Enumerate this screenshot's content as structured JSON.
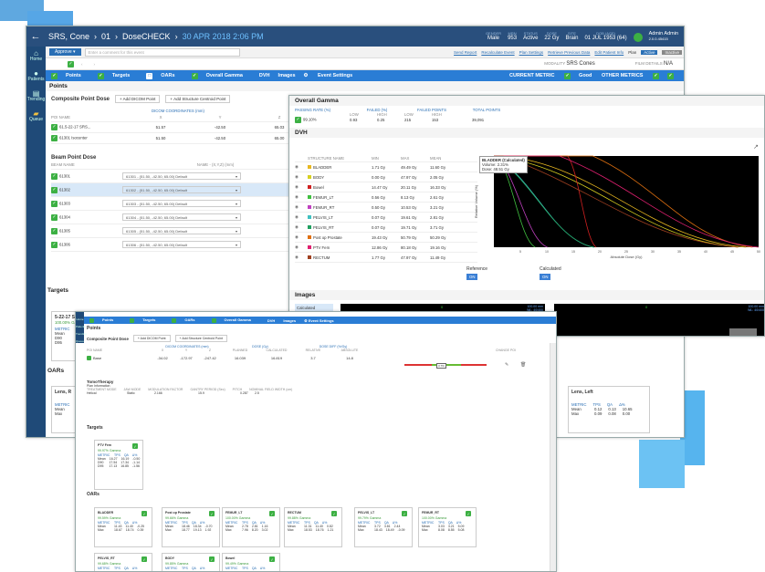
{
  "app": {
    "back_icon": "arrow-left-icon",
    "crumb1": "SRS, Cone",
    "crumb2": "01",
    "crumb3": "DoseCHECK",
    "date": "30 APR 2018 2:06 PM",
    "gender_label": "GENDER",
    "gender": "Male",
    "mrn_label": "MRN",
    "mrn": "953",
    "status_label": "STATUS",
    "status": "Active",
    "dose_label": "DOSE",
    "dose": "22 Gy",
    "site_label": "SITE",
    "site": "Brain",
    "dob_label": "DOB (AGE)",
    "dob": "01 JUL 1953 (64)",
    "user": "Admin Admin",
    "version": "2.0.0.45415"
  },
  "sidebar": {
    "home": "Home",
    "patients": "Patients",
    "trending": "Trending",
    "queue": "Queue"
  },
  "toolbar": {
    "approve": "Approve",
    "comment_placeholder": "Enter a comment for this event",
    "links": [
      "Send Report",
      "Recalculate Event",
      "Plan Settings",
      "Retrieve Previous Data",
      "Edit Patient Info"
    ],
    "plan": "Plan",
    "active": "Active",
    "inactive": "Inactive",
    "modality_label": "MODALITY",
    "modality": "SRS Cones",
    "film_label": "FILM DETAILS",
    "film": "N/A"
  },
  "tabs": {
    "points": "Points",
    "targets": "Targets",
    "oars": "OARs",
    "gamma": "Overall Gamma",
    "dvh": "DVH",
    "images": "Images",
    "event": "Event Settings",
    "current_metric": "CURRENT METRIC",
    "good": "Good",
    "other_metrics": "OTHER METRICS"
  },
  "points": {
    "title": "Points",
    "composite": "Composite Point Dose",
    "add_dicom": "Add DICOM Point",
    "add_structure": "Add Structure Centroid Point",
    "dicom_coords": "DICOM COORDINATES (mm)",
    "poi_name": "POI NAME",
    "x": "X",
    "y": "Y",
    "z": "Z",
    "planned": "PLANNED",
    "rows": [
      {
        "name": "61.5-22-17 SRS...",
        "x": "51.57",
        "y": "-42.50",
        "z": "65.03",
        "p": "22.007"
      },
      {
        "name": "61301 Isocenter",
        "x": "51.50",
        "y": "-42.50",
        "z": "65.00",
        "p": "22.209"
      }
    ],
    "beam": "Beam Point Dose",
    "beam_name": "BEAM NAME",
    "name_col": "NAME - (X,Y,Z) (mm)",
    "beams": [
      {
        "b": "61301",
        "v": "61301 - (51.50, -42.50, 65.00) Default",
        "p": "4.590"
      },
      {
        "b": "61302",
        "v": "61302 - (51.50, -42.50, 65.00) Default",
        "p": "2.791"
      },
      {
        "b": "61303",
        "v": "61303 - (51.50, -42.50, 65.00) Default",
        "p": "4.583"
      },
      {
        "b": "61304",
        "v": "61304 - (51.50, -42.50, 65.00) Default",
        "p": "4.557"
      },
      {
        "b": "61305",
        "v": "61305 - (51.50, -42.50, 65.00) Default",
        "p": "4.642"
      },
      {
        "b": "61306",
        "v": "61306 - (51.50, -42.50, 65.00) Default",
        "p": "4.661"
      }
    ]
  },
  "targets": {
    "title": "Targets",
    "card_name": "5-22-17 SRS",
    "card_pct": "100.00% Gamma",
    "metric": "METRIC",
    "mean": "Mean",
    "d90": "D90",
    "d95": "D95"
  },
  "oars": {
    "title": "OARs",
    "lens_r": "Lens, R",
    "lens_l": "Lens, Left",
    "metric": "METRIC",
    "tps": "TPS",
    "qa": "QA",
    "pct": "Δ%",
    "mean": "Mean",
    "max": "Max",
    "l_mean": [
      "0.12",
      "0.13",
      "10.65"
    ],
    "l_max": [
      "0.09",
      "0.08",
      "0.00"
    ]
  },
  "gamma": {
    "title": "Overall Gamma",
    "passing": "PASSING RATE (%)",
    "failed_pct": "FAILED (%)",
    "failed_pts": "FAILED POINTS",
    "total": "TOTAL POINTS",
    "low": "LOW",
    "high": "HIGH",
    "rate": "99.10%",
    "v1": "0.93",
    "v2": "0.25",
    "v3": "215",
    "v4": "153",
    "v5": "39,091"
  },
  "dvh": {
    "title": "DVH",
    "cols": [
      "STRUCTURE NAME",
      "MIN",
      "MAX",
      "MEAN"
    ],
    "rows": [
      {
        "n": "BLADDER",
        "c": "#e8b820",
        "a": "1.71 Gy",
        "b": "49.49 Gy",
        "m": "11.60 Gy"
      },
      {
        "n": "BODY",
        "c": "#d8d020",
        "a": "0.00 Gy",
        "b": "47.97 Gy",
        "m": "2.05 Gy"
      },
      {
        "n": "Bowel",
        "c": "#d02020",
        "a": "14.47 Gy",
        "b": "20.11 Gy",
        "m": "16.33 Gy"
      },
      {
        "n": "FEMUR_LT",
        "c": "#40c040",
        "a": "0.56 Gy",
        "b": "8.13 Gy",
        "m": "2.61 Gy"
      },
      {
        "n": "FEMUR_RT",
        "c": "#c040c0",
        "a": "0.50 Gy",
        "b": "10.53 Gy",
        "m": "3.21 Gy"
      },
      {
        "n": "PELVIS_LT",
        "c": "#40c0c0",
        "a": "0.07 Gy",
        "b": "19.61 Gy",
        "m": "2.81 Gy"
      },
      {
        "n": "PELVIS_RT",
        "c": "#20a060",
        "a": "0.07 Gy",
        "b": "19.71 Gy",
        "m": "3.71 Gy"
      },
      {
        "n": "Post op Prostate",
        "c": "#e07010",
        "a": "19.43 Gy",
        "b": "50.79 Gy",
        "m": "50.29 Gy"
      },
      {
        "n": "PTV Fem",
        "c": "#e02070",
        "a": "12.86 Gy",
        "b": "80.18 Gy",
        "m": "19.16 Gy"
      },
      {
        "n": "RECTUM",
        "c": "#a04020",
        "a": "1.77 Gy",
        "b": "47.97 Gy",
        "m": "11.49 Gy"
      }
    ],
    "tip_title": "BLADDER (Calculated)",
    "tip_vol": "Volume: 2.31%",
    "tip_dose": "Dose: 48.51 Gy",
    "xlabel": "Absolute Dose (Gy)",
    "ylabel": "Relative Volume (%)",
    "reference": "Reference",
    "calculated": "Calculated",
    "ref_value": "ON",
    "calc_value": "ON"
  },
  "images": {
    "title": "Images",
    "items": [
      "Calculated",
      "Gamma",
      "Planned"
    ],
    "mark": "0",
    "corner1": "100.00 mm",
    "corner2": "WL: 40/400"
  },
  "w3": {
    "dose_gy": "DOSE (Gy)",
    "dose_diff": "DOSE DIFF (%/Gy)",
    "x": "X",
    "y": "Y",
    "z": "Z",
    "planned": "PLANNED",
    "calculated": "CALCULATED",
    "relative": "RELATIVE",
    "absolute": "ABSOLUTE",
    "change_pts": "CHANGE POI",
    "poi": {
      "n": "Base",
      "x": "-34.02",
      "y": "-172.97",
      "z": "-247.42",
      "p": "16.039",
      "c": "16.819",
      "r": "3.7",
      "a": "14.8"
    },
    "slider_val": "3.7%",
    "tomo": "TomoTherapy",
    "plan_info": "Plan Information",
    "tomo_cols": [
      "TREATMENT MODE",
      "JAW MODE",
      "MODULATION FACTOR",
      "GANTRY PERIOD (Sec)",
      "PITCH",
      "NOMINAL FIELD WIDTH (cm)"
    ],
    "tomo_vals": [
      "Helical",
      "Static",
      "2.166",
      "15.9",
      "0.287",
      "2.5"
    ],
    "cards": [
      {
        "n": "PTV Fem",
        "g": "99.97% Gamma",
        "mean": [
          "16.27",
          "16.19",
          "-0.50"
        ],
        "max": [
          "17.54",
          "17.34",
          "-1.14"
        ],
        "x": [
          "17.13",
          "16.85",
          "-1.56"
        ],
        "rowlabels": [
          "Mean",
          "D90",
          "D95"
        ]
      },
      {
        "n": "BLADDER",
        "g": "99.59% Gamma",
        "mean": [
          "11.43",
          "11.40",
          "-0.25"
        ],
        "max": [
          "18.67",
          "18.74",
          "0.39"
        ]
      },
      {
        "n": "Post op Prostate",
        "g": "99.66% Gamma",
        "mean": [
          "18.46",
          "18.34",
          "-0.70"
        ],
        "max": [
          "18.77",
          "19.13",
          "1.92"
        ]
      },
      {
        "n": "FEMUR_LT",
        "g": "100.00% Gamma",
        "mean": [
          "2.78",
          "2.81",
          "1.16"
        ],
        "max": [
          "7.96",
          "8.20",
          "3.02"
        ]
      },
      {
        "n": "RECTUM",
        "g": "99.88% Gamma",
        "mean": [
          "11.31",
          "11.40",
          "0.82"
        ],
        "max": [
          "18.53",
          "18.76",
          "1.21"
        ]
      },
      {
        "n": "PELVIS_LT",
        "g": "99.79% Gamma",
        "mean": [
          "3.72",
          "3.81",
          "2.44"
        ],
        "max": [
          "18.43",
          "18.49",
          "-0.09"
        ]
      },
      {
        "n": "FEMUR_RT",
        "g": "100.00% Gamma",
        "mean": [
          "3.03",
          "3.21",
          "5.09"
        ],
        "max": [
          "8.08",
          "8.55",
          "5.08"
        ]
      },
      {
        "n": "PELVIS_RT",
        "g": "99.68% Gamma"
      },
      {
        "n": "BODY",
        "g": "99.85% Gamma"
      },
      {
        "n": "Bowel",
        "g": "99.49% Gamma"
      }
    ]
  }
}
